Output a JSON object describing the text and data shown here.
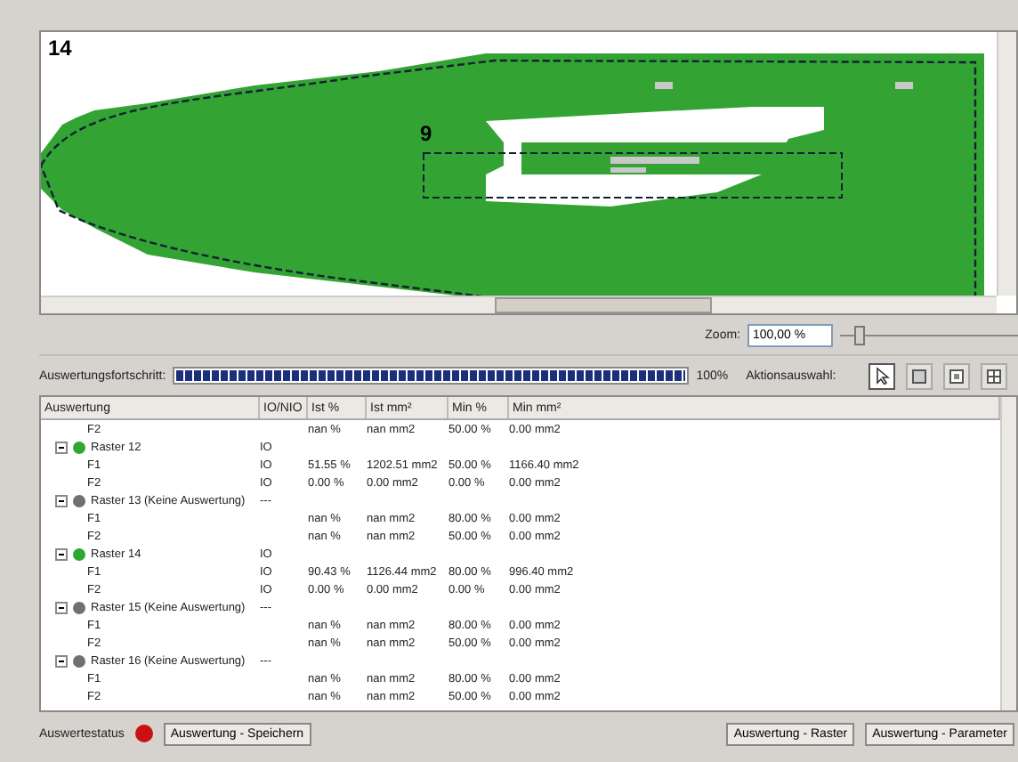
{
  "canvas": {
    "labels": [
      {
        "text": "14",
        "kind": "outer"
      },
      {
        "text": "9",
        "kind": "inner"
      }
    ]
  },
  "zoom": {
    "label": "Zoom:",
    "value": "100,00 %",
    "level": 0.08
  },
  "progress": {
    "label": "Auswertungsfortschritt:",
    "level": 1,
    "reading": "100%"
  },
  "actions": {
    "label": "Aktionsauswahl:",
    "tools": [
      {
        "kind": "pointer",
        "selected": true
      },
      {
        "kind": "square",
        "selected": false
      },
      {
        "kind": "frame",
        "selected": false
      },
      {
        "kind": "split",
        "selected": false
      }
    ]
  },
  "table": {
    "columns": [
      "Auswertung",
      "IO/NIO",
      "Ist %",
      "Ist mm²",
      "Min %",
      "Min mm²"
    ],
    "rows": [
      {
        "kind": "leaf",
        "cells": [
          "F2",
          "",
          "nan %",
          "nan mm2",
          "50.00 %",
          "0.00 mm2"
        ]
      },
      {
        "kind": "group",
        "color": "#2fa82f",
        "expanded": true,
        "cells": [
          "Raster 12",
          "IO",
          "",
          "",
          "",
          ""
        ],
        "children": [
          {
            "kind": "leaf",
            "cells": [
              "F1",
              "IO",
              "51.55 %",
              "1202.51 mm2",
              "50.00 %",
              "1166.40 mm2"
            ]
          },
          {
            "kind": "leaf",
            "cells": [
              "F2",
              "IO",
              "0.00 %",
              "0.00 mm2",
              "0.00 %",
              "0.00 mm2"
            ]
          }
        ]
      },
      {
        "kind": "group",
        "color": "#707070",
        "expanded": true,
        "cells": [
          "Raster 13 (Keine Auswertung)",
          "---",
          "",
          "",
          "",
          ""
        ],
        "children": [
          {
            "kind": "leaf",
            "cells": [
              "F1",
              "",
              "nan %",
              "nan mm2",
              "80.00 %",
              "0.00 mm2"
            ]
          },
          {
            "kind": "leaf",
            "cells": [
              "F2",
              "",
              "nan %",
              "nan mm2",
              "50.00 %",
              "0.00 mm2"
            ]
          }
        ]
      },
      {
        "kind": "group",
        "color": "#2fa82f",
        "expanded": true,
        "cells": [
          "Raster 14",
          "IO",
          "",
          "",
          "",
          ""
        ],
        "children": [
          {
            "kind": "leaf",
            "cells": [
              "F1",
              "IO",
              "90.43 %",
              "1126.44 mm2",
              "80.00 %",
              "996.40 mm2"
            ]
          },
          {
            "kind": "leaf",
            "cells": [
              "F2",
              "IO",
              "0.00 %",
              "0.00 mm2",
              "0.00 %",
              "0.00 mm2"
            ]
          }
        ]
      },
      {
        "kind": "group",
        "color": "#707070",
        "expanded": true,
        "cells": [
          "Raster 15 (Keine Auswertung)",
          "---",
          "",
          "",
          "",
          ""
        ],
        "children": [
          {
            "kind": "leaf",
            "cells": [
              "F1",
              "",
              "nan %",
              "nan mm2",
              "80.00 %",
              "0.00 mm2"
            ]
          },
          {
            "kind": "leaf",
            "cells": [
              "F2",
              "",
              "nan %",
              "nan mm2",
              "50.00 %",
              "0.00 mm2"
            ]
          }
        ]
      },
      {
        "kind": "group",
        "color": "#707070",
        "expanded": true,
        "cells": [
          "Raster 16 (Keine Auswertung)",
          "---",
          "",
          "",
          "",
          ""
        ],
        "children": [
          {
            "kind": "leaf",
            "cells": [
              "F1",
              "",
              "nan %",
              "nan mm2",
              "80.00 %",
              "0.00 mm2"
            ]
          },
          {
            "kind": "leaf",
            "cells": [
              "F2",
              "",
              "nan %",
              "nan mm2",
              "50.00 %",
              "0.00 mm2"
            ]
          }
        ]
      }
    ]
  },
  "footer": {
    "status_label": "Auswertestatus",
    "error": true,
    "save_button": "Auswertung - Speichern",
    "buttons": [
      "Auswertung - Raster",
      "Auswertung - Parameter"
    ]
  }
}
